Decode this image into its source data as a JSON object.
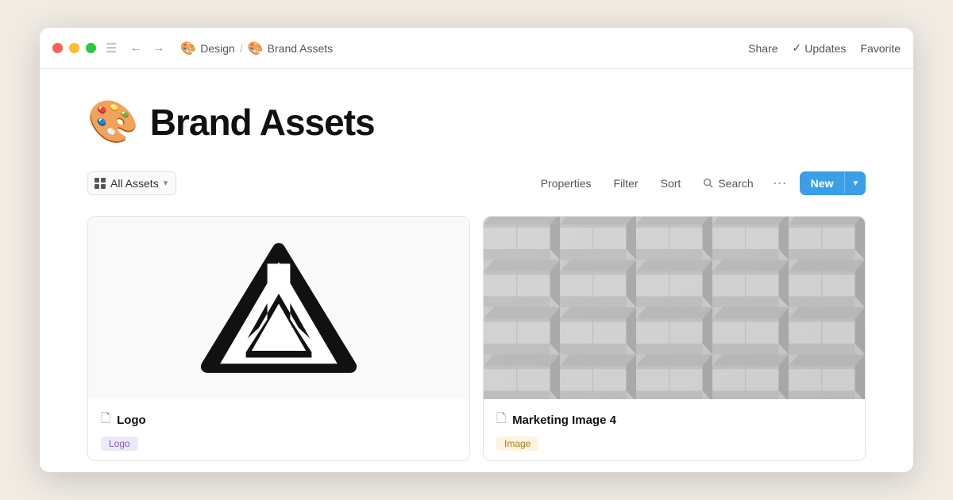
{
  "window": {
    "title": "Brand Assets"
  },
  "titlebar": {
    "breadcrumb": [
      {
        "emoji": "🎨",
        "label": "Design"
      },
      {
        "emoji": "🎨",
        "label": "Brand Assets"
      }
    ],
    "actions": [
      {
        "id": "share",
        "label": "Share"
      },
      {
        "id": "updates",
        "label": "Updates",
        "prefix": "✓"
      },
      {
        "id": "favorite",
        "label": "Favorite"
      }
    ]
  },
  "page": {
    "emoji": "🎨",
    "title": "Brand Assets"
  },
  "toolbar": {
    "view_label": "All Assets",
    "properties_label": "Properties",
    "filter_label": "Filter",
    "sort_label": "Sort",
    "search_label": "Search",
    "more_label": "•••",
    "new_label": "New"
  },
  "cards": [
    {
      "id": "logo",
      "name": "Logo",
      "type": "logo",
      "tag": "Logo",
      "tag_style": "logo"
    },
    {
      "id": "marketing-image-4",
      "name": "Marketing Image 4",
      "type": "photo",
      "tag": "Image",
      "tag_style": "image"
    }
  ]
}
